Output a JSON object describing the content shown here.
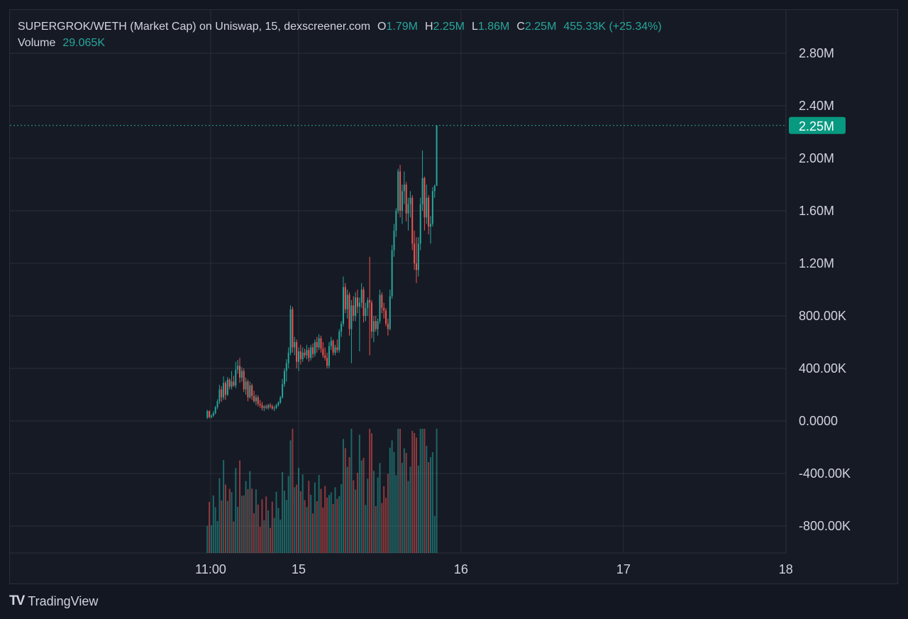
{
  "header": {
    "title": "SUPERGROK/WETH (Market Cap) on Uniswap, 15, dexscreener.com",
    "o_label": "O",
    "o_value": "1.79M",
    "h_label": "H",
    "h_value": "2.25M",
    "l_label": "L",
    "l_value": "1.86M",
    "c_label": "C",
    "c_value": "2.25M",
    "change": "455.33K (+25.34%)",
    "volume_label": "Volume",
    "volume_value": "29.065K"
  },
  "price_badge": "2.25M",
  "footer": {
    "logo": "TV",
    "brand": "TradingView"
  },
  "colors": {
    "up": "#26a69a",
    "down": "#ef5350",
    "background": "#161a25",
    "grid": "#2a2e39",
    "text": "#d1d4dc",
    "badge": "#089981"
  },
  "chart_data": {
    "type": "candlestick",
    "title": "SUPERGROK/WETH (Market Cap) on Uniswap, 15, dexscreener.com",
    "y_ticks": [
      "2.80M",
      "2.40M",
      "2.00M",
      "1.60M",
      "1.20M",
      "800.00K",
      "400.00K",
      "0.0000",
      "-400.00K",
      "-800.00K"
    ],
    "y_tick_values": [
      2800000,
      2400000,
      2000000,
      1600000,
      1200000,
      800000,
      400000,
      0,
      -400000,
      -800000
    ],
    "x_ticks": [
      "11:00",
      "15",
      "16",
      "17",
      "18"
    ],
    "x_tick_positions_hours": [
      0,
      13,
      37,
      61,
      85
    ],
    "last_price": 2250000,
    "grid": true,
    "series": [
      {
        "name": "Market Cap",
        "points": [
          [
            -0.5,
            25000,
            85000,
            15000,
            75000
          ],
          [
            -0.2,
            75000,
            80000,
            20000,
            30000
          ],
          [
            0.1,
            30000,
            50000,
            20000,
            40000
          ],
          [
            0.4,
            40000,
            75000,
            30000,
            60000
          ],
          [
            0.7,
            60000,
            115000,
            50000,
            105000
          ],
          [
            1.0,
            105000,
            165000,
            90000,
            150000
          ],
          [
            1.3,
            150000,
            275000,
            130000,
            240000
          ],
          [
            1.6,
            240000,
            265000,
            145000,
            180000
          ],
          [
            1.9,
            180000,
            340000,
            160000,
            290000
          ],
          [
            2.2,
            290000,
            305000,
            160000,
            200000
          ],
          [
            2.5,
            200000,
            335000,
            190000,
            315000
          ],
          [
            2.8,
            315000,
            325000,
            240000,
            260000
          ],
          [
            3.1,
            260000,
            380000,
            240000,
            300000
          ],
          [
            3.4,
            300000,
            345000,
            260000,
            270000
          ],
          [
            3.7,
            270000,
            450000,
            250000,
            390000
          ],
          [
            4.0,
            390000,
            465000,
            360000,
            420000
          ],
          [
            4.3,
            420000,
            480000,
            290000,
            330000
          ],
          [
            4.6,
            330000,
            410000,
            300000,
            380000
          ],
          [
            4.9,
            380000,
            400000,
            220000,
            240000
          ],
          [
            5.2,
            240000,
            330000,
            200000,
            300000
          ],
          [
            5.5,
            300000,
            315000,
            150000,
            180000
          ],
          [
            5.8,
            180000,
            300000,
            170000,
            270000
          ],
          [
            6.1,
            270000,
            285000,
            160000,
            190000
          ],
          [
            6.4,
            190000,
            230000,
            140000,
            150000
          ],
          [
            6.7,
            150000,
            200000,
            120000,
            180000
          ],
          [
            7.0,
            180000,
            195000,
            110000,
            130000
          ],
          [
            7.3,
            130000,
            160000,
            100000,
            120000
          ],
          [
            7.6,
            120000,
            145000,
            80000,
            100000
          ],
          [
            7.9,
            100000,
            120000,
            75000,
            110000
          ],
          [
            8.2,
            110000,
            125000,
            90000,
            100000
          ],
          [
            8.5,
            100000,
            130000,
            85000,
            120000
          ],
          [
            8.8,
            120000,
            135000,
            95000,
            110000
          ],
          [
            9.1,
            110000,
            125000,
            85000,
            95000
          ],
          [
            9.4,
            95000,
            115000,
            75000,
            100000
          ],
          [
            9.7,
            100000,
            130000,
            90000,
            120000
          ],
          [
            10.0,
            120000,
            150000,
            110000,
            140000
          ],
          [
            10.3,
            140000,
            190000,
            130000,
            180000
          ],
          [
            10.6,
            180000,
            320000,
            170000,
            280000
          ],
          [
            10.9,
            280000,
            400000,
            260000,
            380000
          ],
          [
            11.2,
            380000,
            470000,
            300000,
            440000
          ],
          [
            11.5,
            440000,
            560000,
            400000,
            520000
          ],
          [
            11.8,
            520000,
            880000,
            500000,
            850000
          ],
          [
            12.1,
            850000,
            870000,
            520000,
            560000
          ],
          [
            12.4,
            560000,
            640000,
            500000,
            600000
          ],
          [
            12.7,
            600000,
            620000,
            400000,
            450000
          ],
          [
            13.0,
            450000,
            560000,
            380000,
            530000
          ],
          [
            13.3,
            530000,
            580000,
            430000,
            470000
          ],
          [
            13.6,
            470000,
            560000,
            450000,
            520000
          ],
          [
            13.9,
            520000,
            550000,
            480000,
            500000
          ],
          [
            14.2,
            500000,
            580000,
            470000,
            540000
          ],
          [
            14.5,
            540000,
            560000,
            450000,
            480000
          ],
          [
            14.8,
            480000,
            580000,
            460000,
            560000
          ],
          [
            15.1,
            560000,
            590000,
            480000,
            510000
          ],
          [
            15.4,
            510000,
            620000,
            490000,
            600000
          ],
          [
            15.7,
            600000,
            640000,
            520000,
            560000
          ],
          [
            16.0,
            560000,
            660000,
            540000,
            630000
          ],
          [
            16.3,
            630000,
            650000,
            520000,
            550000
          ],
          [
            16.6,
            550000,
            600000,
            480000,
            500000
          ],
          [
            16.9,
            500000,
            560000,
            460000,
            480000
          ],
          [
            17.2,
            480000,
            520000,
            400000,
            420000
          ],
          [
            17.5,
            420000,
            600000,
            400000,
            570000
          ],
          [
            17.8,
            570000,
            640000,
            540000,
            610000
          ],
          [
            18.1,
            610000,
            620000,
            500000,
            520000
          ],
          [
            18.4,
            520000,
            580000,
            500000,
            560000
          ],
          [
            18.7,
            560000,
            620000,
            520000,
            540000
          ],
          [
            19.0,
            540000,
            700000,
            520000,
            680000
          ],
          [
            19.3,
            680000,
            760000,
            640000,
            740000
          ],
          [
            19.6,
            740000,
            1100000,
            720000,
            1020000
          ],
          [
            19.9,
            1020000,
            1050000,
            820000,
            850000
          ],
          [
            20.2,
            850000,
            1000000,
            780000,
            960000
          ],
          [
            20.5,
            960000,
            980000,
            650000,
            700000
          ],
          [
            20.8,
            700000,
            920000,
            440000,
            880000
          ],
          [
            21.1,
            880000,
            950000,
            760000,
            800000
          ],
          [
            21.4,
            800000,
            980000,
            760000,
            940000
          ],
          [
            21.7,
            940000,
            1000000,
            820000,
            870000
          ],
          [
            22.0,
            870000,
            940000,
            530000,
            900000
          ],
          [
            22.3,
            900000,
            1050000,
            860000,
            1000000
          ],
          [
            22.6,
            1000000,
            1020000,
            750000,
            800000
          ],
          [
            22.9,
            800000,
            900000,
            760000,
            860000
          ],
          [
            23.2,
            860000,
            940000,
            800000,
            920000
          ],
          [
            23.5,
            920000,
            1250000,
            500000,
            900000
          ],
          [
            23.8,
            900000,
            920000,
            630000,
            680000
          ],
          [
            24.1,
            680000,
            800000,
            600000,
            760000
          ],
          [
            24.4,
            760000,
            800000,
            680000,
            700000
          ],
          [
            24.7,
            700000,
            780000,
            650000,
            760000
          ],
          [
            25.0,
            760000,
            1000000,
            740000,
            960000
          ],
          [
            25.3,
            960000,
            980000,
            820000,
            860000
          ],
          [
            25.6,
            860000,
            900000,
            780000,
            840000
          ],
          [
            25.9,
            840000,
            860000,
            720000,
            740000
          ],
          [
            26.2,
            740000,
            780000,
            650000,
            700000
          ],
          [
            26.5,
            700000,
            1000000,
            690000,
            950000
          ],
          [
            26.8,
            950000,
            1340000,
            930000,
            1300000
          ],
          [
            27.1,
            1300000,
            1500000,
            1250000,
            1450000
          ],
          [
            27.4,
            1450000,
            1620000,
            1400000,
            1600000
          ],
          [
            27.7,
            1600000,
            1920000,
            1580000,
            1900000
          ],
          [
            28.0,
            1900000,
            1950000,
            1550000,
            1600000
          ],
          [
            28.3,
            1600000,
            1800000,
            1500000,
            1750000
          ],
          [
            28.6,
            1750000,
            1900000,
            1650000,
            1800000
          ],
          [
            28.9,
            1800000,
            1820000,
            1520000,
            1580000
          ],
          [
            29.2,
            1580000,
            1700000,
            1450000,
            1650000
          ],
          [
            29.5,
            1650000,
            1750000,
            1550000,
            1700000
          ],
          [
            29.8,
            1700000,
            1720000,
            1300000,
            1350000
          ],
          [
            30.1,
            1350000,
            1450000,
            1150000,
            1200000
          ],
          [
            30.4,
            1200000,
            1400000,
            1050000,
            1150000
          ],
          [
            30.7,
            1150000,
            1400000,
            1100000,
            1350000
          ],
          [
            31.0,
            1350000,
            1700000,
            1300000,
            1650000
          ],
          [
            31.3,
            1650000,
            2060000,
            1600000,
            1850000
          ],
          [
            31.6,
            1850000,
            1860000,
            1450000,
            1550000
          ],
          [
            31.9,
            1550000,
            1800000,
            1500000,
            1700000
          ],
          [
            32.2,
            1700000,
            1720000,
            1420000,
            1480000
          ],
          [
            32.5,
            1480000,
            1560000,
            1350000,
            1500000
          ],
          [
            32.8,
            1500000,
            1780000,
            1480000,
            1750000
          ],
          [
            33.1,
            1750000,
            1800000,
            1700000,
            1790000
          ],
          [
            33.4,
            1790000,
            2250000,
            1860000,
            2250000
          ]
        ]
      }
    ],
    "volume_max_label": "29.065K"
  }
}
